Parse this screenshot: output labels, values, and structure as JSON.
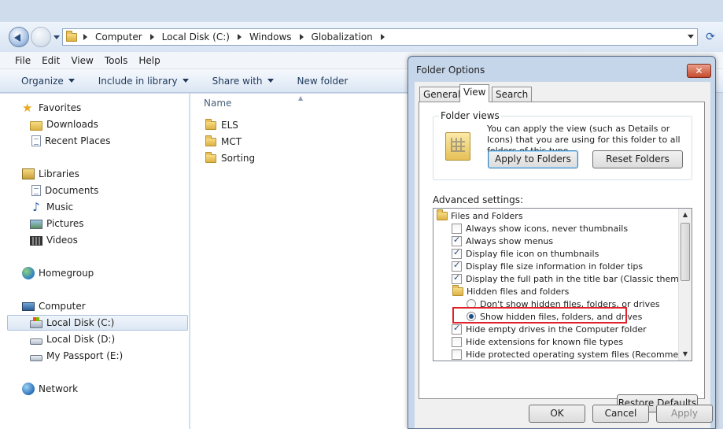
{
  "address_bar": {
    "crumbs": [
      "Computer",
      "Local Disk (C:)",
      "Windows",
      "Globalization"
    ]
  },
  "menu": [
    "File",
    "Edit",
    "View",
    "Tools",
    "Help"
  ],
  "toolbar": {
    "organize": "Organize",
    "include": "Include in library",
    "share": "Share with",
    "new_folder": "New folder"
  },
  "nav": {
    "favorites": "Favorites",
    "downloads": "Downloads",
    "recent": "Recent Places",
    "libraries": "Libraries",
    "documents": "Documents",
    "music": "Music",
    "pictures": "Pictures",
    "videos": "Videos",
    "homegroup": "Homegroup",
    "computer": "Computer",
    "local_c": "Local Disk (C:)",
    "local_d": "Local Disk (D:)",
    "passport": "My Passport (E:)",
    "network": "Network"
  },
  "content": {
    "column": "Name",
    "files": [
      "ELS",
      "MCT",
      "Sorting"
    ]
  },
  "dialog": {
    "title": "Folder Options",
    "close": "✕",
    "tabs": [
      "General",
      "View",
      "Search"
    ],
    "folder_views_legend": "Folder views",
    "folder_views_text": "You can apply the view (such as Details or Icons) that you are using for this folder to all folders of this type.",
    "apply_to_folders": "Apply to Folders",
    "reset_folders": "Reset Folders",
    "advanced_label": "Advanced settings:",
    "settings": {
      "files_and_folders": "Files and Folders",
      "always_icons": "Always show icons, never thumbnails",
      "always_menus": "Always show menus",
      "display_file_icon": "Display file icon on thumbnails",
      "display_size": "Display file size information in folder tips",
      "display_full_path": "Display the full path in the title bar (Classic theme only)",
      "hidden_files": "Hidden files and folders",
      "dont_show_hidden": "Don't show hidden files, folders, or drives",
      "show_hidden": "Show hidden files, folders, and drives",
      "hide_empty": "Hide empty drives in the Computer folder",
      "hide_ext": "Hide extensions for known file types",
      "hide_protected": "Hide protected operating system files (Recommended)"
    },
    "restore_defaults": "Restore Defaults",
    "ok": "OK",
    "cancel": "Cancel",
    "apply": "Apply"
  }
}
